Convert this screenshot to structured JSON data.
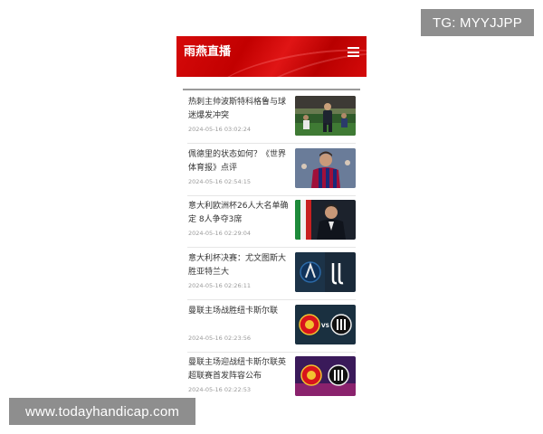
{
  "watermarks": {
    "telegram": "TG: MYYJJPP",
    "site": "www.todayhandicap.com"
  },
  "header": {
    "logo": "雨燕直播",
    "menu_icon": "hamburger-menu-icon",
    "bg_color": "#c80000"
  },
  "news": [
    {
      "title": "热刺主帅波斯特科格鲁与球迷爆发冲突",
      "time": "2024-05-16 03:02:24",
      "thumb": "coach-stadium-photo"
    },
    {
      "title": "佩德里的状态如何？《世界体育报》点评",
      "time": "2024-05-16 02:54:15",
      "thumb": "barcelona-player-photo"
    },
    {
      "title": "意大利欧洲杯26人大名单确定 8人争夺3席",
      "time": "2024-05-16 02:29:04",
      "thumb": "italy-coach-photo"
    },
    {
      "title": "意大利杯决赛：尤文图斯大胜亚特兰大",
      "time": "2024-05-16 02:26:11",
      "thumb": "atalanta-vs-juventus-logos"
    },
    {
      "title": "曼联主场战胜纽卡斯尔联",
      "time": "2024-05-16 02:23:56",
      "thumb": "manutd-vs-newcastle-logos"
    },
    {
      "title": "曼联主场迎战纽卡斯尔联英超联赛首发阵容公布",
      "time": "2024-05-16 02:22:53",
      "thumb": "manutd-newcastle-purple-logos"
    }
  ],
  "vs_label": "VS"
}
